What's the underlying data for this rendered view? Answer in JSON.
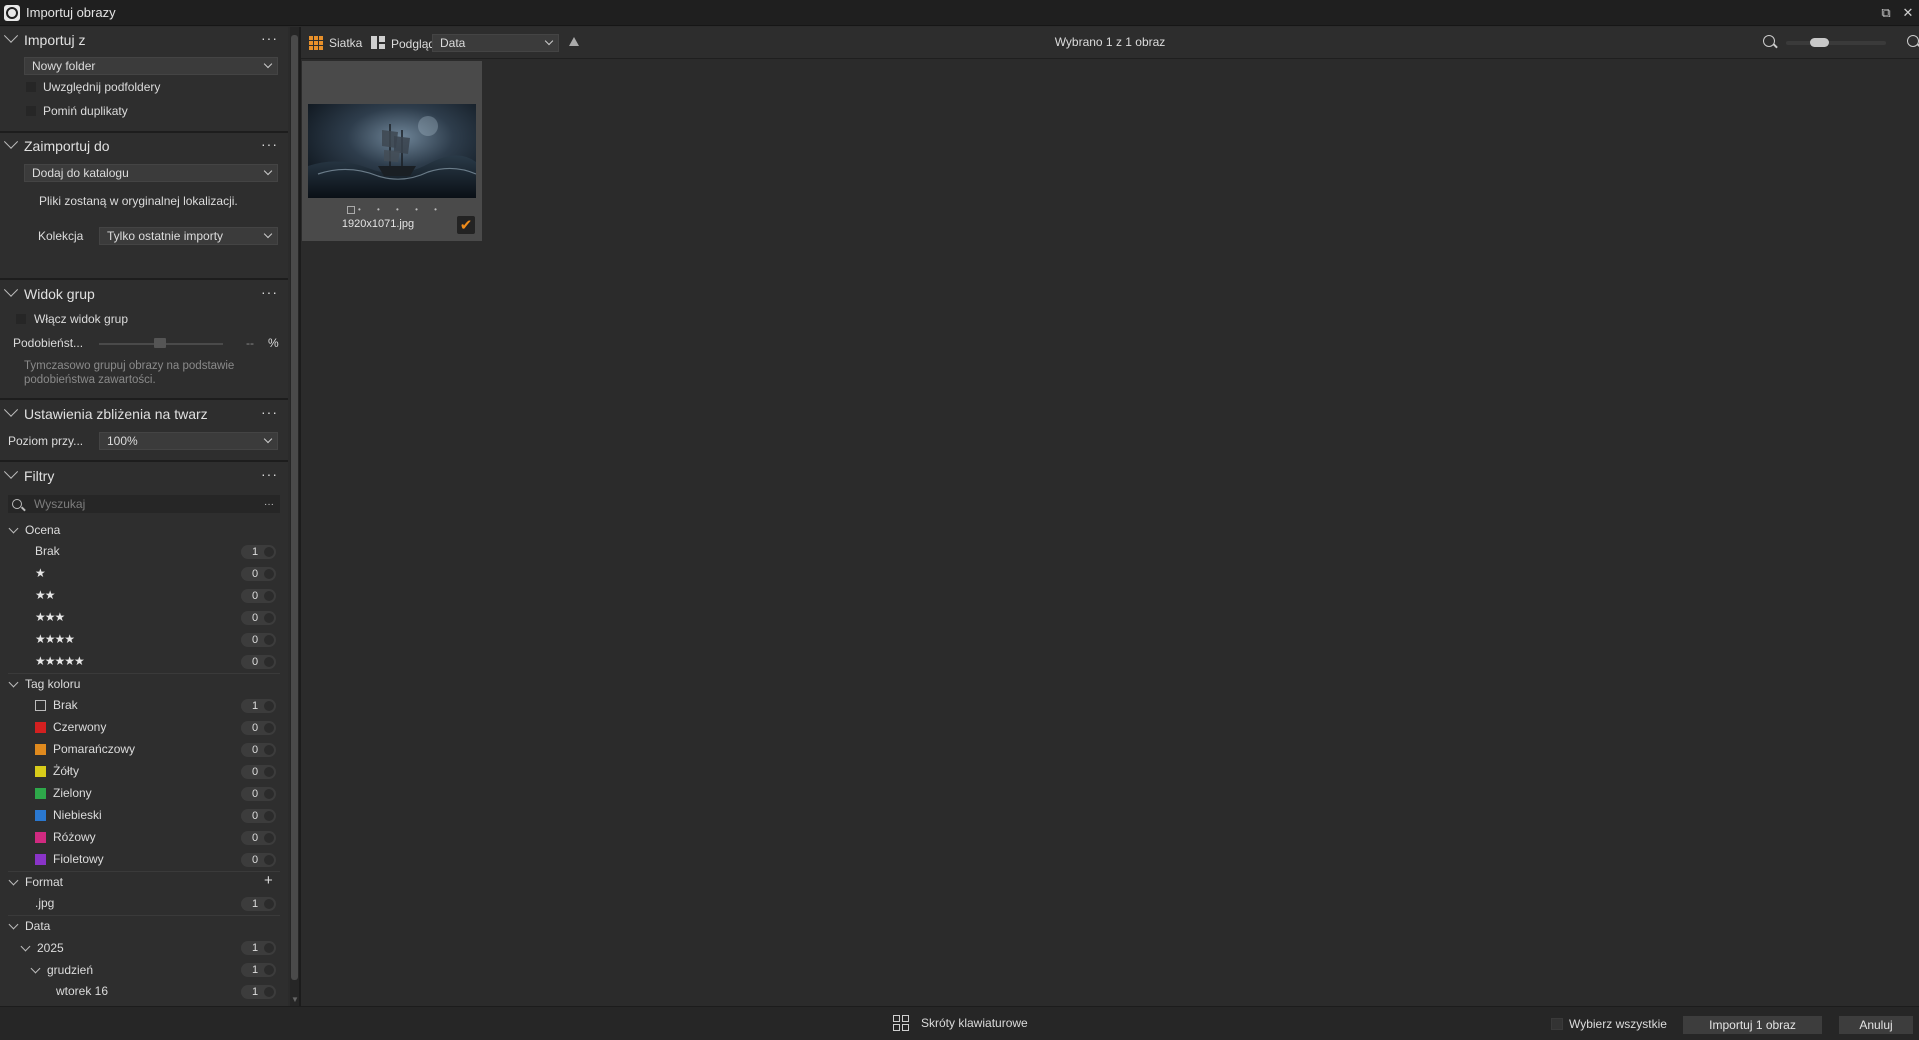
{
  "window": {
    "title": "Importuj obrazy",
    "restore_glyph": "⧉",
    "close_glyph": "✕"
  },
  "import_from": {
    "title": "Importuj z",
    "source": "Nowy folder",
    "include_subfolders": "Uwzględnij podfoldery",
    "skip_duplicates": "Pomiń duplikaty"
  },
  "import_to": {
    "title": "Zaimportuj do",
    "destination": "Dodaj do katalogu",
    "note": "Pliki zostaną w oryginalnej lokalizacji.",
    "collection_label": "Kolekcja",
    "collection_value": "Tylko ostatnie importy"
  },
  "group_view": {
    "title": "Widok grup",
    "enable": "Włącz widok grup",
    "similarity_label": "Podobieńst...",
    "similarity_value": "--",
    "similarity_unit": "%",
    "hint_line1": "Tymczasowo grupuj obrazy na podstawie",
    "hint_line2": "podobieństwa zawartości."
  },
  "face_zoom": {
    "title": "Ustawienia zbliżenia na twarz",
    "level_label": "Poziom przy...",
    "level_value": "100%"
  },
  "filters": {
    "title": "Filtry",
    "search_placeholder": "Wyszukaj",
    "search_more": "···",
    "rating": {
      "title": "Ocena",
      "items": [
        {
          "label": "Brak",
          "stars": "",
          "count": "1"
        },
        {
          "label": "",
          "stars": "★",
          "count": "0"
        },
        {
          "label": "",
          "stars": "★★",
          "count": "0"
        },
        {
          "label": "",
          "stars": "★★★",
          "count": "0"
        },
        {
          "label": "",
          "stars": "★★★★",
          "count": "0"
        },
        {
          "label": "",
          "stars": "★★★★★",
          "count": "0"
        }
      ]
    },
    "color_tag": {
      "title": "Tag koloru",
      "items": [
        {
          "label": "Brak",
          "color": "none",
          "count": "1"
        },
        {
          "label": "Czerwony",
          "color": "#d32020",
          "count": "0"
        },
        {
          "label": "Pomarańczowy",
          "color": "#e08a1e",
          "count": "0"
        },
        {
          "label": "Żółty",
          "color": "#d8cc1a",
          "count": "0"
        },
        {
          "label": "Zielony",
          "color": "#2ea84a",
          "count": "0"
        },
        {
          "label": "Niebieski",
          "color": "#2a78d0",
          "count": "0"
        },
        {
          "label": "Różowy",
          "color": "#d02a80",
          "count": "0"
        },
        {
          "label": "Fioletowy",
          "color": "#8a34c8",
          "count": "0"
        }
      ]
    },
    "format": {
      "title": "Format",
      "items": [
        {
          "label": ".jpg",
          "count": "1"
        }
      ]
    },
    "date": {
      "title": "Data",
      "year": "2025",
      "year_count": "1",
      "month": "grudzień",
      "month_count": "1",
      "day": "wtorek 16",
      "day_count": "1"
    }
  },
  "toolbar": {
    "grid_label": "Siatka",
    "preview_label": "Podgląd",
    "sort_value": "Data",
    "selected_text": "Wybrano 1 z 1 obraz",
    "zoom_level": 0.3
  },
  "thumbnail": {
    "filename": "1920x1071.jpg",
    "checkmark": "✔",
    "dots": "• • • • •"
  },
  "bottom": {
    "shortcuts": "Skróty klawiaturowe",
    "select_all": "Wybierz wszystkie",
    "import_button": "Importuj 1 obraz",
    "cancel_button": "Anuluj"
  },
  "colors": {
    "accent": "#e8902a"
  }
}
